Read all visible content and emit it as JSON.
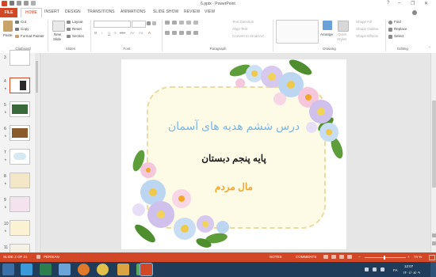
{
  "window": {
    "title": "6.pptx - PowerPoint",
    "qat_icons": [
      "save-icon",
      "undo-icon",
      "redo-icon",
      "start-from-beginning-icon"
    ],
    "controls": {
      "help": "?",
      "minimize": "–",
      "restore": "❐",
      "close": "✕"
    }
  },
  "ribbon_tabs": {
    "file": "FILE",
    "home": "HOME",
    "insert": "INSERT",
    "design": "DESIGN",
    "transitions": "TRANSITIONS",
    "animations": "ANIMATIONS",
    "slide_show": "SLIDE SHOW",
    "review": "REVIEW",
    "view": "VIEW"
  },
  "ribbon": {
    "clipboard": {
      "label": "Clipboard",
      "paste": "Paste",
      "cut": "Cut",
      "copy": "Copy",
      "format_painter": "Format Painter"
    },
    "slides": {
      "label": "Slides",
      "new_slide": "New",
      "new_slide_2": "Slide",
      "layout": "Layout",
      "reset": "Reset",
      "section": "Section"
    },
    "font": {
      "label": "Font",
      "bold": "B",
      "italic": "I",
      "underline": "U",
      "strike": "S",
      "abc": "abc",
      "av": "AV",
      "aa": "Aa",
      "font_color": "A"
    },
    "paragraph": {
      "label": "Paragraph",
      "text_direction": "Text Direction",
      "align_text": "Align Text",
      "convert_smartart": "Convert to SmartArt"
    },
    "drawing": {
      "label": "Drawing",
      "arrange": "Arrange",
      "quick_styles": "Quick",
      "quick_styles_2": "Styles",
      "shape_fill": "Shape Fill",
      "shape_outline": "Shape Outline",
      "shape_effects": "Shape Effects"
    },
    "editing": {
      "label": "Editing",
      "find": "Find",
      "replace": "Replace",
      "select": "Select"
    }
  },
  "thumbnails": [
    {
      "number": "3"
    },
    {
      "number": "4"
    },
    {
      "number": "5"
    },
    {
      "number": "6"
    },
    {
      "number": "7"
    },
    {
      "number": "8"
    },
    {
      "number": "9"
    },
    {
      "number": "10"
    },
    {
      "number": "11"
    }
  ],
  "slide": {
    "title": "درس ششم هدیه های آسمان",
    "subtitle": "پایه پنجم دبستان",
    "footer": "مال مردم",
    "colors": {
      "title": "#7ab6e6",
      "subtitle": "#1b1b1b",
      "footer": "#f3a72a"
    }
  },
  "status_bar": {
    "slide_info": "SLIDE 2 OF 21",
    "language": "PERSIAN",
    "notes": "NOTES",
    "comments": "COMMENTS",
    "zoom": "74 %"
  },
  "taskbar": {
    "time": "12:07",
    "date": "۱۴۰۱/۰۸/۰۹",
    "lang": "FA"
  },
  "colors": {
    "accent": "#d24726",
    "taskbar": "#1f3d5a"
  }
}
